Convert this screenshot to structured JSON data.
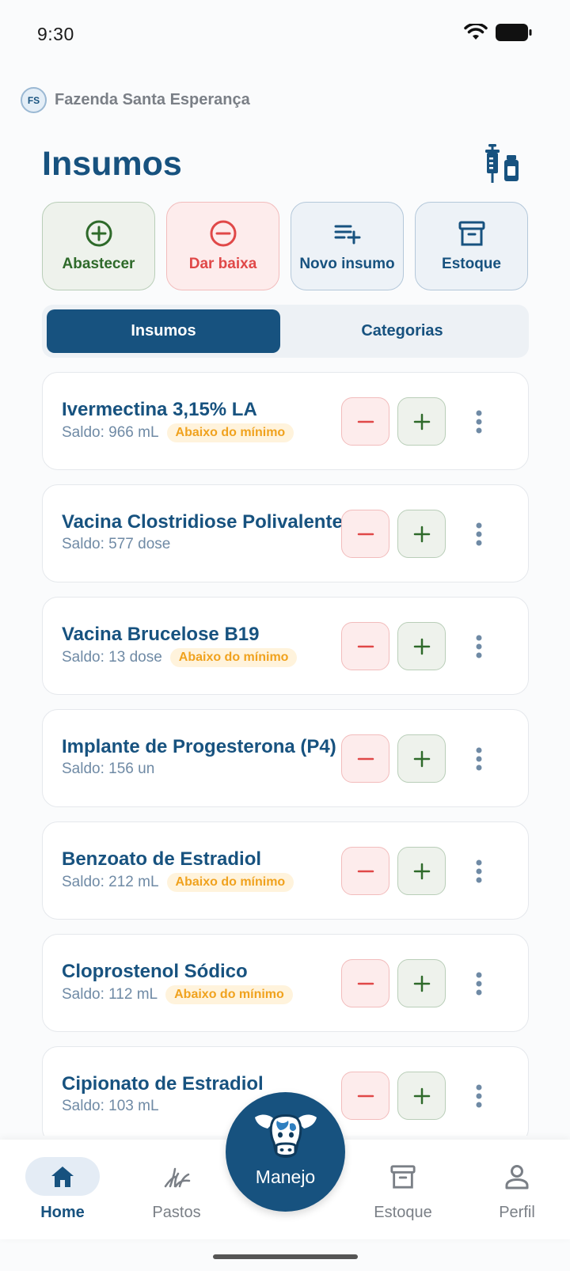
{
  "status": {
    "time": "9:30"
  },
  "farm": {
    "initials": "FS",
    "name": "Fazenda Santa Esperança"
  },
  "page": {
    "title": "Insumos",
    "header_icon": "syringe-vial-icon"
  },
  "actions": [
    {
      "label": "Abastecer",
      "icon": "plus-circle-icon"
    },
    {
      "label": "Dar baixa",
      "icon": "minus-circle-icon"
    },
    {
      "label": "Novo insumo",
      "icon": "playlist-add-icon"
    },
    {
      "label": "Estoque",
      "icon": "archive-icon"
    }
  ],
  "tabs": [
    {
      "label": "Insumos",
      "active": true
    },
    {
      "label": "Categorias",
      "active": false
    }
  ],
  "badge_label": "Abaixo do mínimo",
  "items": [
    {
      "name": "Ivermectina 3,15% LA",
      "balance": "Saldo: 966 mL",
      "below_min": true
    },
    {
      "name": "Vacina Clostridiose Polivalente",
      "balance": "Saldo: 577 dose",
      "below_min": false
    },
    {
      "name": "Vacina Brucelose B19",
      "balance": "Saldo: 13 dose",
      "below_min": true
    },
    {
      "name": "Implante de Progesterona (P4)",
      "balance": "Saldo: 156 un",
      "below_min": false
    },
    {
      "name": "Benzoato de Estradiol",
      "balance": "Saldo: 212 mL",
      "below_min": true
    },
    {
      "name": "Cloprostenol Sódico",
      "balance": "Saldo: 112 mL",
      "below_min": true
    },
    {
      "name": "Cipionato de Estradiol",
      "balance": "Saldo: 103 mL",
      "below_min": false
    }
  ],
  "nav": {
    "home": "Home",
    "pastos": "Pastos",
    "manejo": "Manejo",
    "estoque": "Estoque",
    "perfil": "Perfil"
  },
  "colors": {
    "primary": "#17527f",
    "success": "#2e6a2a",
    "danger": "#e04848",
    "warning": "#f0a21e"
  }
}
